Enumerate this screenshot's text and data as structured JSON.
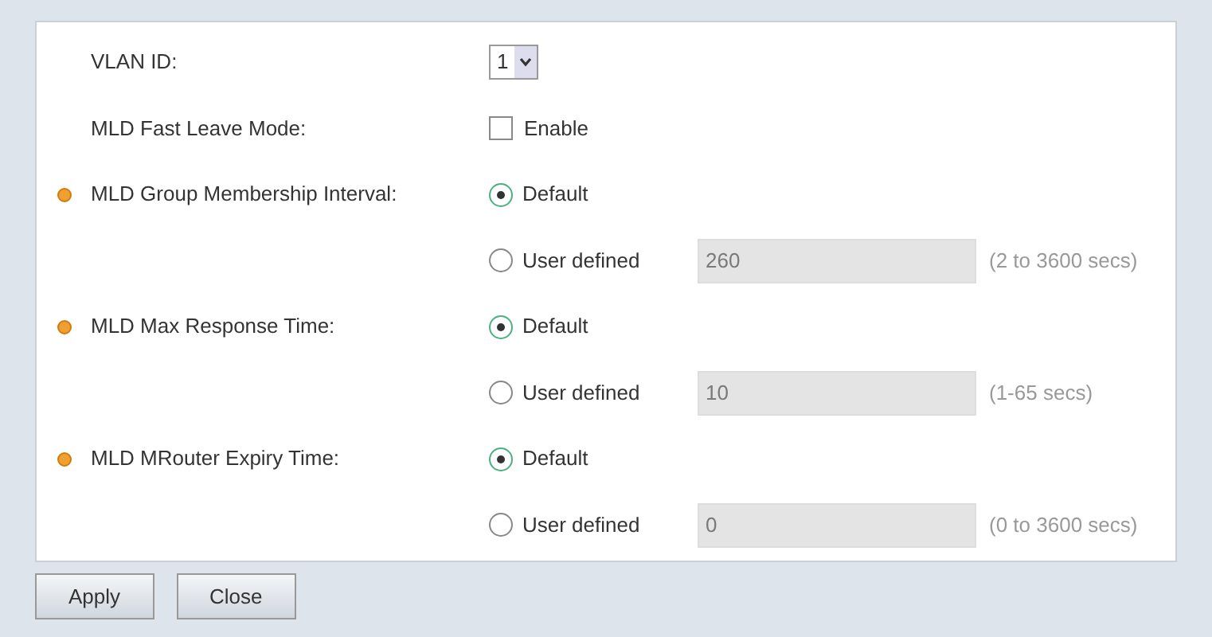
{
  "fields": [
    {
      "kind": "select",
      "label": "VLAN ID:",
      "value": "1"
    },
    {
      "kind": "checkbox",
      "label": "MLD Fast Leave Mode:",
      "option": "Enable",
      "checked": false
    },
    {
      "kind": "radio",
      "label": "MLD Group Membership Interval:",
      "required": true,
      "options": [
        {
          "label": "Default",
          "selected": true
        },
        {
          "label": "User defined",
          "selected": false,
          "value": "260",
          "disabled": true,
          "hint": "(2 to 3600 secs)"
        }
      ]
    },
    {
      "kind": "radio",
      "label": "MLD Max Response Time:",
      "required": true,
      "options": [
        {
          "label": "Default",
          "selected": true
        },
        {
          "label": "User defined",
          "selected": false,
          "value": "10",
          "disabled": true,
          "hint": "(1-65 secs)"
        }
      ]
    },
    {
      "kind": "radio",
      "label": "MLD MRouter Expiry Time:",
      "required": true,
      "options": [
        {
          "label": "Default",
          "selected": true
        },
        {
          "label": "User defined",
          "selected": false,
          "value": "0",
          "disabled": true,
          "hint": "(0 to 3600 secs)"
        }
      ]
    }
  ],
  "buttons": [
    "Apply",
    "Close"
  ]
}
